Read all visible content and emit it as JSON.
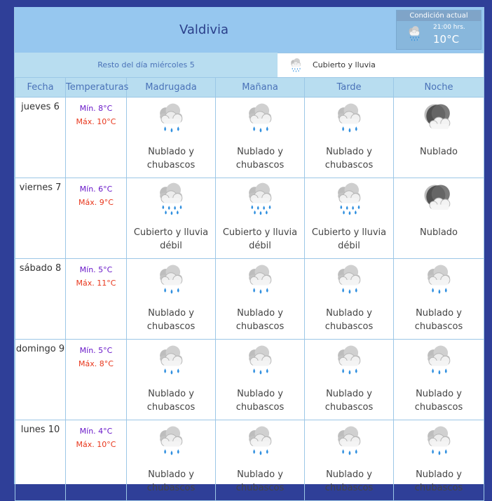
{
  "city": "Valdivia",
  "current": {
    "label": "Condición actual",
    "time": "21:00 hrs.",
    "temp": "10°C",
    "icon": "cloud-rain-icon"
  },
  "today": {
    "label": "Resto del día miércoles 5",
    "condition": "Cubierto y lluvia",
    "icon": "cloud-rain-icon"
  },
  "columns": [
    "Fecha",
    "Temperaturas",
    "Madrugada",
    "Mañana",
    "Tarde",
    "Noche"
  ],
  "rows": [
    {
      "day": "jueves 6",
      "min": "Mín. 8°C",
      "max": "Máx. 10°C",
      "periods": [
        {
          "icon": "cloud-showers-icon",
          "text": "Nublado y chubascos"
        },
        {
          "icon": "cloud-showers-icon",
          "text": "Nublado y chubascos"
        },
        {
          "icon": "cloud-showers-icon",
          "text": "Nublado y chubascos"
        },
        {
          "icon": "cloud-moon-icon",
          "text": "Nublado"
        }
      ]
    },
    {
      "day": "viernes 7",
      "min": "Mín. 6°C",
      "max": "Máx. 9°C",
      "periods": [
        {
          "icon": "cloud-rain-icon",
          "text": "Cubierto y lluvia débil"
        },
        {
          "icon": "cloud-rain-icon",
          "text": "Cubierto y lluvia débil"
        },
        {
          "icon": "cloud-rain-icon",
          "text": "Cubierto y lluvia débil"
        },
        {
          "icon": "cloud-moon-icon",
          "text": "Nublado"
        }
      ]
    },
    {
      "day": "sábado 8",
      "min": "Mín. 5°C",
      "max": "Máx. 11°C",
      "periods": [
        {
          "icon": "cloud-showers-icon",
          "text": "Nublado y chubascos"
        },
        {
          "icon": "cloud-showers-icon",
          "text": "Nublado y chubascos"
        },
        {
          "icon": "cloud-showers-icon",
          "text": "Nublado y chubascos"
        },
        {
          "icon": "cloud-showers-icon",
          "text": "Nublado y chubascos"
        }
      ]
    },
    {
      "day": "domingo 9",
      "min": "Mín. 5°C",
      "max": "Máx. 8°C",
      "periods": [
        {
          "icon": "cloud-showers-icon",
          "text": "Nublado y chubascos"
        },
        {
          "icon": "cloud-showers-icon",
          "text": "Nublado y chubascos"
        },
        {
          "icon": "cloud-showers-icon",
          "text": "Nublado y chubascos"
        },
        {
          "icon": "cloud-showers-icon",
          "text": "Nublado y chubascos"
        }
      ]
    },
    {
      "day": "lunes 10",
      "min": "Mín. 4°C",
      "max": "Máx. 10°C",
      "periods": [
        {
          "icon": "cloud-showers-icon",
          "text": "Nublado y chubascos"
        },
        {
          "icon": "cloud-showers-icon",
          "text": "Nublado y chubascos"
        },
        {
          "icon": "cloud-showers-icon",
          "text": "Nublado y chubascos"
        },
        {
          "icon": "cloud-showers-icon",
          "text": "Nublado y chubascos"
        }
      ]
    }
  ]
}
